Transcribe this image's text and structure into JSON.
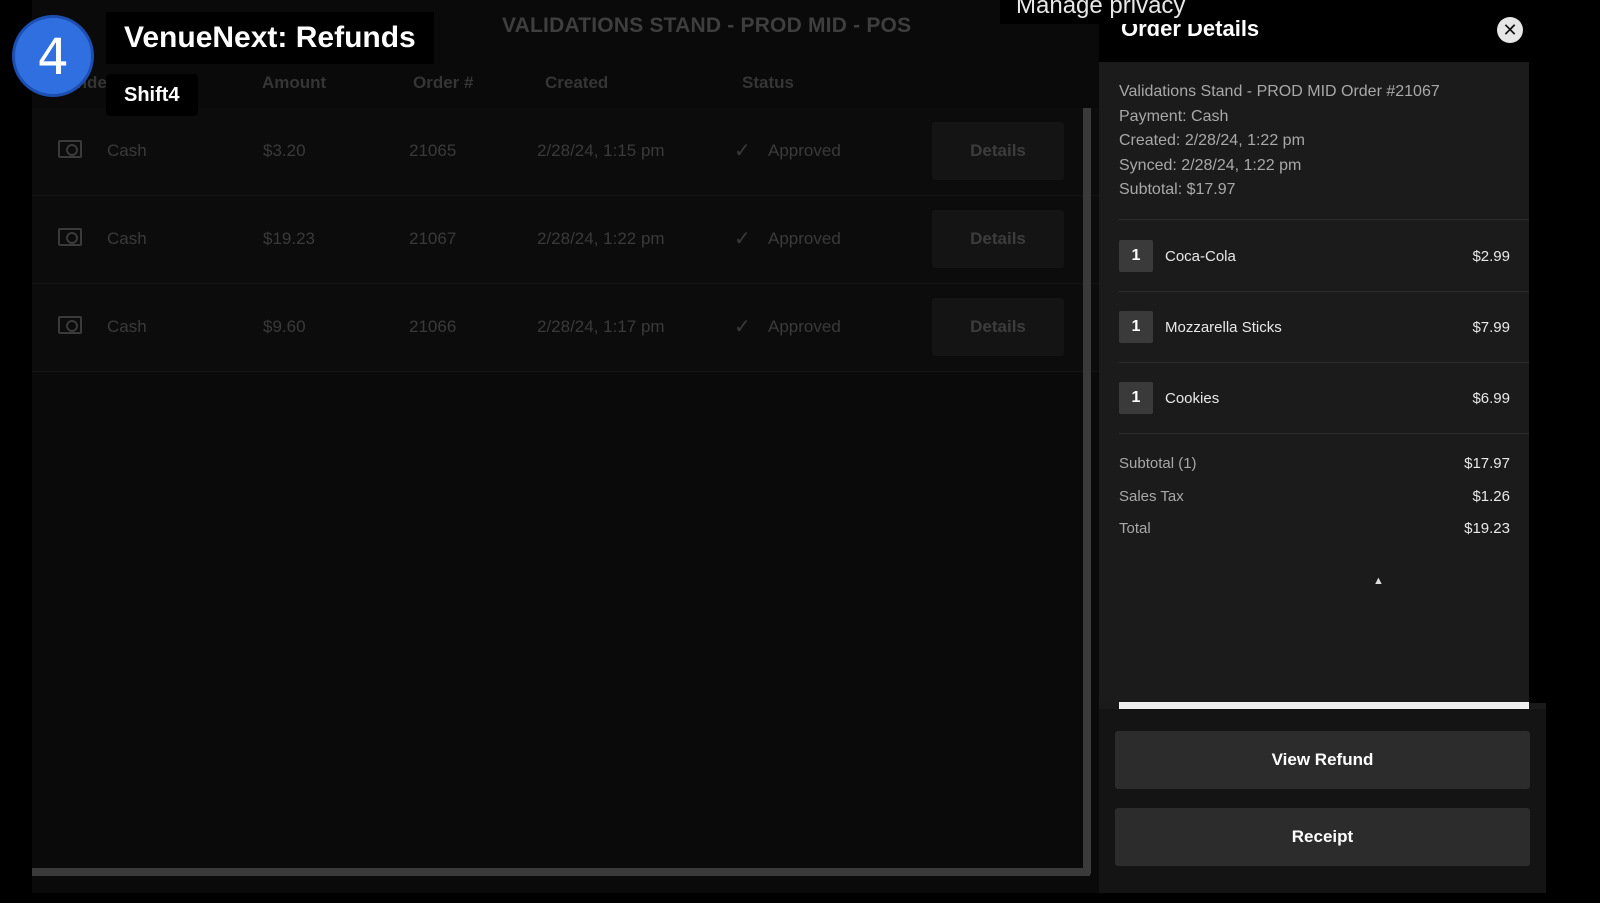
{
  "app": {
    "title": "VALIDATIONS STAND - PROD MID - POS",
    "columns": [
      "Tender",
      "Amount",
      "Order #",
      "Created",
      "Status"
    ],
    "rows": [
      {
        "tender": "Cash",
        "amount": "$3.20",
        "order": "21065",
        "created": "2/28/24, 1:15 pm",
        "status": "Approved",
        "action": "Details"
      },
      {
        "tender": "Cash",
        "amount": "$19.23",
        "order": "21067",
        "created": "2/28/24, 1:22 pm",
        "status": "Approved",
        "action": "Details"
      },
      {
        "tender": "Cash",
        "amount": "$9.60",
        "order": "21066",
        "created": "2/28/24, 1:17 pm",
        "status": "Approved",
        "action": "Details"
      }
    ]
  },
  "guide": {
    "step": "4",
    "title": "VenueNext: Refunds",
    "subtitle": "Shift4",
    "privacy": "Manage privacy"
  },
  "drawer": {
    "title": "Order Details",
    "info": [
      "Validations Stand - PROD MID Order #21067",
      "Payment: Cash",
      "Created: 2/28/24, 1:22 pm",
      "Synced: 2/28/24, 1:22 pm",
      "Subtotal: $17.97"
    ],
    "items": [
      {
        "qty": "1",
        "name": "Coca-Cola",
        "price": "$2.99"
      },
      {
        "qty": "1",
        "name": "Mozzarella Sticks",
        "price": "$7.99"
      },
      {
        "qty": "1",
        "name": "Cookies",
        "price": "$6.99"
      }
    ],
    "summary": [
      {
        "label": "Subtotal (1)",
        "value": "$17.97"
      },
      {
        "label": "Sales Tax",
        "value": "$1.26"
      },
      {
        "label": "Total",
        "value": "$19.23"
      }
    ],
    "buttons": {
      "view_refund": "View Refund",
      "receipt": "Receipt"
    }
  },
  "icons": {
    "tender": "cash-icon",
    "status": "check-icon",
    "close": "close-icon"
  }
}
